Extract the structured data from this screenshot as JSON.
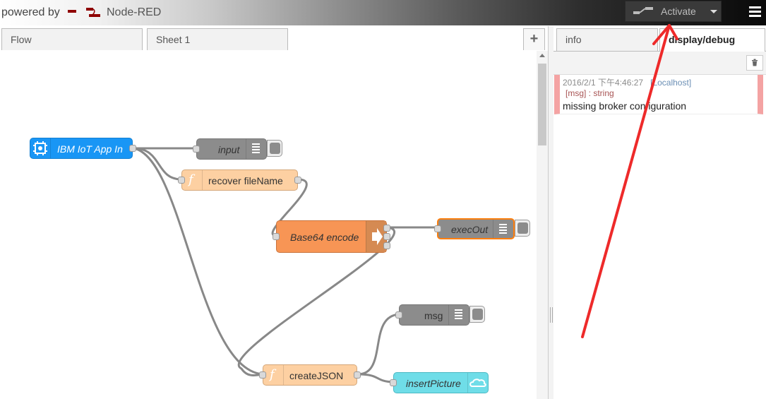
{
  "header": {
    "powered_by": "powered by",
    "app_name": "Node-RED",
    "deploy_label": "Activate",
    "logo_icon": "node-red-logo-icon",
    "menu_icon": "hamburger-menu-icon"
  },
  "workspace": {
    "tabs": [
      {
        "label": "Flow"
      },
      {
        "label": "Sheet 1"
      }
    ],
    "add_tab_label": "+"
  },
  "nodes": {
    "ibm_iot": {
      "label": "IBM IoT App In",
      "color": "#1996f5"
    },
    "input": {
      "label": "input",
      "color": "#8c8c8c"
    },
    "recover": {
      "label": "recover fileName",
      "color": "#fdd0a2"
    },
    "base64": {
      "label": "Base64 encode",
      "color": "#f79555"
    },
    "execout": {
      "label": "execOut",
      "color": "#8c8c8c"
    },
    "msg": {
      "label": "msg",
      "color": "#8c8c8c"
    },
    "createjson": {
      "label": "createJSON",
      "color": "#fdd0a2"
    },
    "insertpicture": {
      "label": "insertPicture",
      "color": "#6fdde8"
    }
  },
  "sidebar": {
    "tabs": [
      {
        "label": "info"
      },
      {
        "label": "display/debug"
      }
    ],
    "active_tab": "display/debug",
    "debug_message": {
      "timestamp": "2016/2/1 下午4:46:27",
      "source": "[Localhost]",
      "type": "[msg] : string",
      "text": "missing broker configuration"
    }
  },
  "annotation_color": "#ee2a2a"
}
